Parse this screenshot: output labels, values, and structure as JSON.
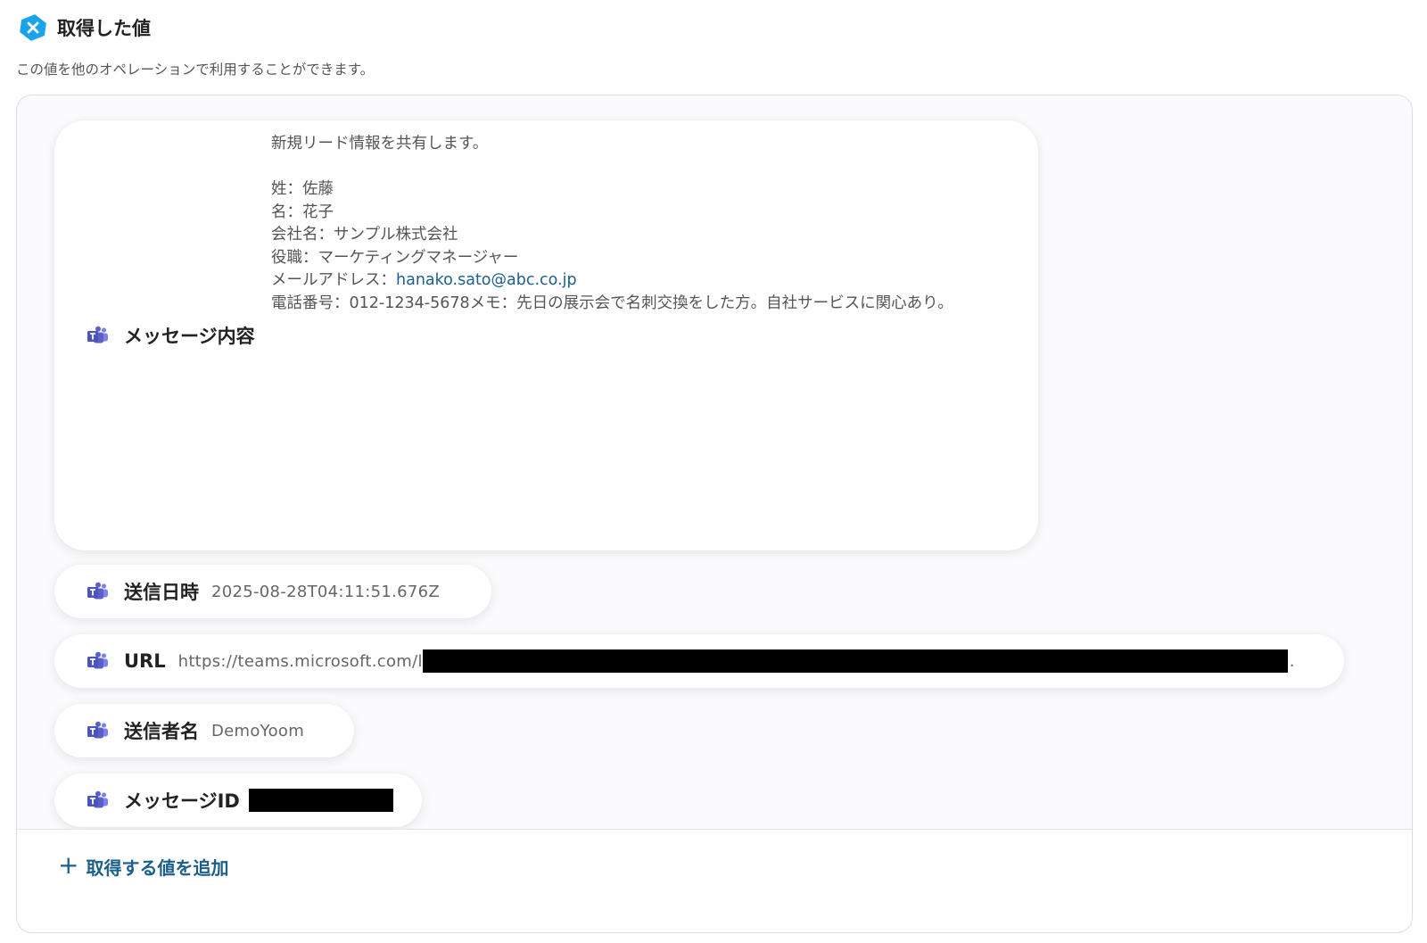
{
  "header": {
    "title": "取得した値",
    "subtitle": "この値を他のオペレーションで利用することができます。"
  },
  "items": [
    {
      "label": "メッセージ内容",
      "icon": "teams-icon",
      "value_lines": [
        "新規リード情報を共有します。",
        "",
        "姓：佐藤",
        "名：花子",
        "会社名：サンプル株式会社",
        "役職：マーケティングマネージャー"
      ],
      "email_prefix": "メールアドレス：",
      "email": "hanako.sato@abc.co.jp",
      "last_line": "電話番号：012-1234-5678メモ：先日の展示会で名刺交換をした方。自社サービスに関心あり。"
    },
    {
      "label": "送信日時",
      "icon": "teams-icon",
      "value": "2025-08-28T04:11:51.676Z"
    },
    {
      "label": "URL",
      "icon": "teams-icon",
      "value": "https://teams.microsoft.com/l",
      "redacted": true,
      "value_suffix": "."
    },
    {
      "label": "送信者名",
      "icon": "teams-icon",
      "value": "DemoYoom"
    },
    {
      "label": "メッセージID",
      "icon": "teams-icon",
      "redacted": true
    }
  ],
  "footer": {
    "add_button_label": "取得する値を追加"
  },
  "colors": {
    "accent": "#1b5f8c",
    "logo": "#1aa3e8",
    "teams_purple": "#5b5fc7"
  }
}
